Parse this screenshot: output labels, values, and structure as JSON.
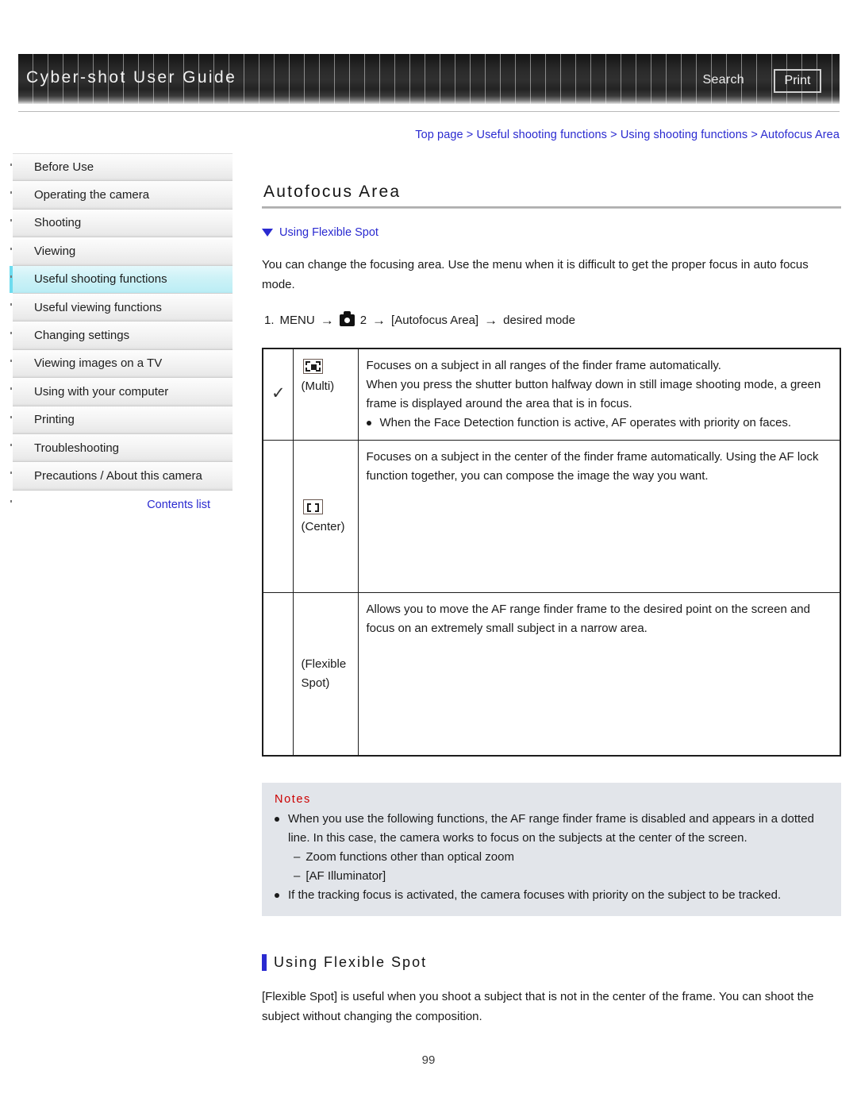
{
  "header": {
    "title": "Cyber-shot User Guide",
    "search_label": "Search",
    "print_label": "Print"
  },
  "breadcrumb": {
    "text": "Top page > Useful shooting functions > Using shooting functions > Autofocus Area"
  },
  "sidebar": {
    "items": [
      {
        "label": "Before Use",
        "active": false
      },
      {
        "label": "Operating the camera",
        "active": false
      },
      {
        "label": "Shooting",
        "active": false
      },
      {
        "label": "Viewing",
        "active": false
      },
      {
        "label": "Useful shooting functions",
        "active": true
      },
      {
        "label": "Useful viewing functions",
        "active": false
      },
      {
        "label": "Changing settings",
        "active": false
      },
      {
        "label": "Viewing images on a TV",
        "active": false
      },
      {
        "label": "Using with your computer",
        "active": false
      },
      {
        "label": "Printing",
        "active": false
      },
      {
        "label": "Troubleshooting",
        "active": false
      },
      {
        "label": "Precautions / About this camera",
        "active": false
      }
    ],
    "contents_list_label": "Contents list"
  },
  "main": {
    "page_title": "Autofocus Area",
    "jump_link_label": "Using Flexible Spot",
    "intro_paragraph": "You can change the focusing area. Use the menu when it is difficult to get the proper focus in auto focus mode.",
    "step": {
      "number": "1.",
      "menu_label": "MENU",
      "arrow": "→",
      "camera_icon_name": "camera-mode-icon",
      "tab_number": "2",
      "target_label": "[Autofocus Area]",
      "result_label": "desired mode"
    },
    "table": {
      "rows": [
        {
          "selected": true,
          "check_glyph": "✓",
          "icon_name": "af-multi-icon",
          "mode_label": "(Multi)",
          "description_lines": [
            "Focuses on a subject in all ranges of the finder frame automatically.",
            "When you press the shutter button halfway down in still image shooting mode, a green frame is displayed around the area that is in focus."
          ],
          "bullets": [
            "When the Face Detection function is active, AF operates with priority on faces."
          ]
        },
        {
          "selected": false,
          "check_glyph": "",
          "icon_name": "af-center-icon",
          "mode_label": "(Center)",
          "description_lines": [
            "Focuses on a subject in the center of the finder frame automatically. Using the AF lock function together, you can compose the image the way you want."
          ],
          "bullets": []
        },
        {
          "selected": false,
          "check_glyph": "",
          "icon_name": "af-flexible-spot-icon",
          "mode_label": "(Flexible Spot)",
          "description_lines": [
            "Allows you to move the AF range finder frame to the desired point on the screen and focus on an extremely small subject in a narrow area."
          ],
          "bullets": []
        }
      ]
    },
    "notes": {
      "title": "Notes",
      "items": [
        "When you use the following functions, the AF range finder frame is disabled and appears in a dotted line. In this case, the camera works to focus on the subjects at the center of the screen.",
        "If the tracking focus is activated, the camera focuses with priority on the subject to be tracked."
      ],
      "sub_items": [
        "Zoom functions other than optical zoom",
        "[AF Illuminator]"
      ],
      "dash_glyph": "–"
    },
    "subsection": {
      "heading": "Using Flexible Spot",
      "paragraph": "[Flexible Spot] is useful when you shoot a subject that is not in the center of the frame. You can shoot the subject without changing the composition."
    }
  },
  "footer": {
    "page_number": "99"
  },
  "colors": {
    "link_blue": "#2a2ad0",
    "notes_red": "#cc0000",
    "active_nav": "#cdf2f7",
    "notes_bg": "#e2e5ea"
  }
}
